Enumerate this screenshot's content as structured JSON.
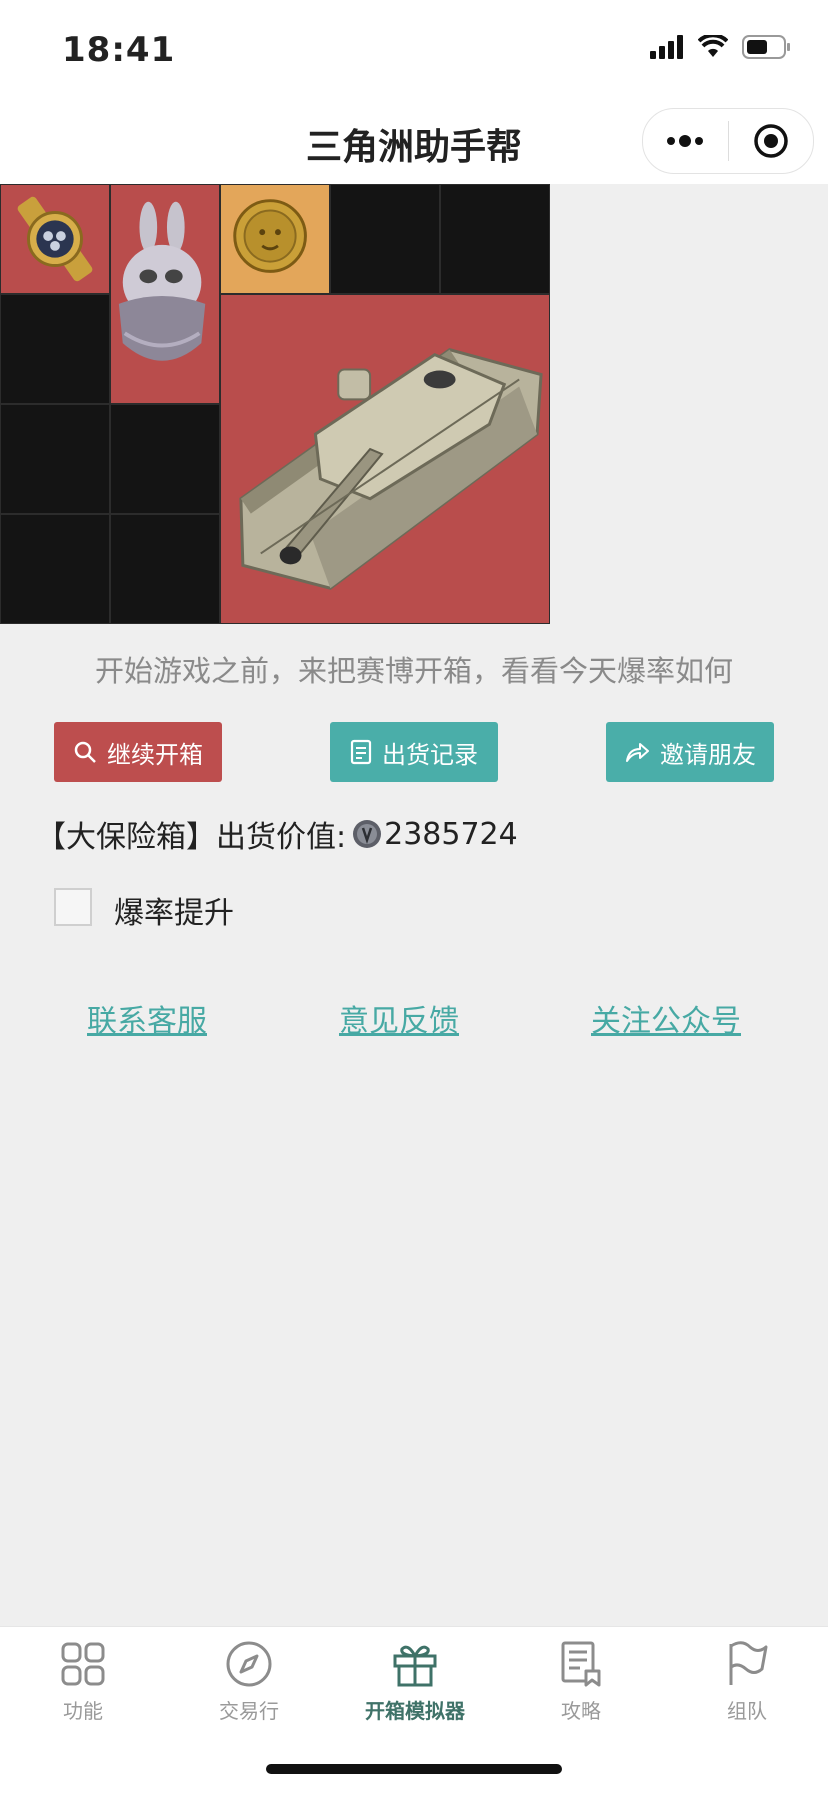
{
  "status_bar": {
    "time": "18:41"
  },
  "nav": {
    "title": "三角洲助手帮"
  },
  "grid": {
    "items": [
      {
        "name": "gold-watch",
        "bg": "red"
      },
      {
        "name": "rabbit-egg",
        "bg": "red"
      },
      {
        "name": "gold-coin-face",
        "bg": "gold"
      },
      {
        "name": "tank",
        "bg": "red"
      }
    ]
  },
  "intro_text": "开始游戏之前，来把赛博开箱，看看今天爆率如何",
  "buttons": {
    "continue": "继续开箱",
    "records": "出货记录",
    "invite": "邀请朋友"
  },
  "value": {
    "prefix": "【大保险箱】出货价值:",
    "amount": "2385724"
  },
  "boost_label": "爆率提升",
  "links": {
    "service": "联系客服",
    "feedback": "意见反馈",
    "follow": "关注公众号"
  },
  "tabs": [
    {
      "label": "功能",
      "icon": "grid-icon"
    },
    {
      "label": "交易行",
      "icon": "compass-icon"
    },
    {
      "label": "开箱模拟器",
      "icon": "gift-icon",
      "active": true
    },
    {
      "label": "攻略",
      "icon": "document-icon"
    },
    {
      "label": "组队",
      "icon": "flag-icon"
    }
  ],
  "colors": {
    "red": "#b94d4c",
    "teal": "#4aaea9",
    "gold": "#e3a65a",
    "active_tab": "#3f7268"
  }
}
